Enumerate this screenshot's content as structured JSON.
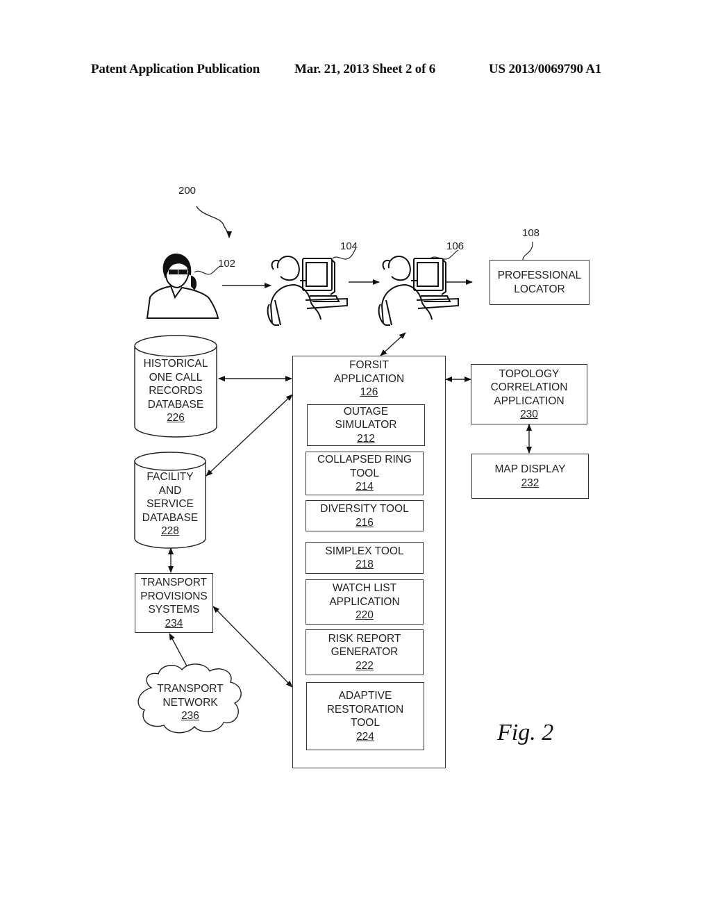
{
  "header": {
    "left": "Patent Application Publication",
    "middle": "Mar. 21, 2013  Sheet 2 of 6",
    "right": "US 2013/0069790 A1"
  },
  "figure": {
    "ref": "200",
    "caption": "Fig. 2"
  },
  "people": {
    "caller": {
      "ref": "102",
      "icon": "caller-on-phone-icon"
    },
    "operator_1": {
      "ref": "104",
      "icon": "operator-at-computer-icon"
    },
    "operator_2": {
      "ref": "106",
      "icon": "operator-at-computer-icon"
    }
  },
  "professional_locator": {
    "ref": "108",
    "line1": "PROFESSIONAL",
    "line2": "LOCATOR"
  },
  "forsit": {
    "line1": "FORSIT",
    "line2": "APPLICATION",
    "num": "126"
  },
  "modules": [
    {
      "line1": "OUTAGE",
      "line2": "SIMULATOR",
      "num": "212"
    },
    {
      "line1": "COLLAPSED RING",
      "line2": "TOOL",
      "num": "214"
    },
    {
      "line1": "DIVERSITY TOOL",
      "num": "216"
    },
    {
      "line1": "SIMPLEX TOOL",
      "num": "218"
    },
    {
      "line1": "WATCH LIST",
      "line2": "APPLICATION",
      "num": "220"
    },
    {
      "line1": "RISK REPORT",
      "line2": "GENERATOR",
      "num": "222"
    },
    {
      "line1": "ADAPTIVE",
      "line2": "RESTORATION",
      "line3": "TOOL",
      "num": "224"
    }
  ],
  "historical_db": {
    "line1": "HISTORICAL",
    "line2": "ONE CALL",
    "line3": "RECORDS",
    "line4": "DATABASE",
    "num": "226"
  },
  "facility_db": {
    "line1": "FACILITY",
    "line2": "AND",
    "line3": "SERVICE",
    "line4": "DATABASE",
    "num": "228"
  },
  "topology": {
    "line1": "TOPOLOGY",
    "line2": "CORRELATION",
    "line3": "APPLICATION",
    "num": "230"
  },
  "map_display": {
    "line1": "MAP DISPLAY",
    "num": "232"
  },
  "transport_provisions": {
    "line1": "TRANSPORT",
    "line2": "PROVISIONS",
    "line3": "SYSTEMS",
    "num": "234"
  },
  "transport_network": {
    "line1": "TRANSPORT",
    "line2": "NETWORK",
    "num": "236"
  }
}
